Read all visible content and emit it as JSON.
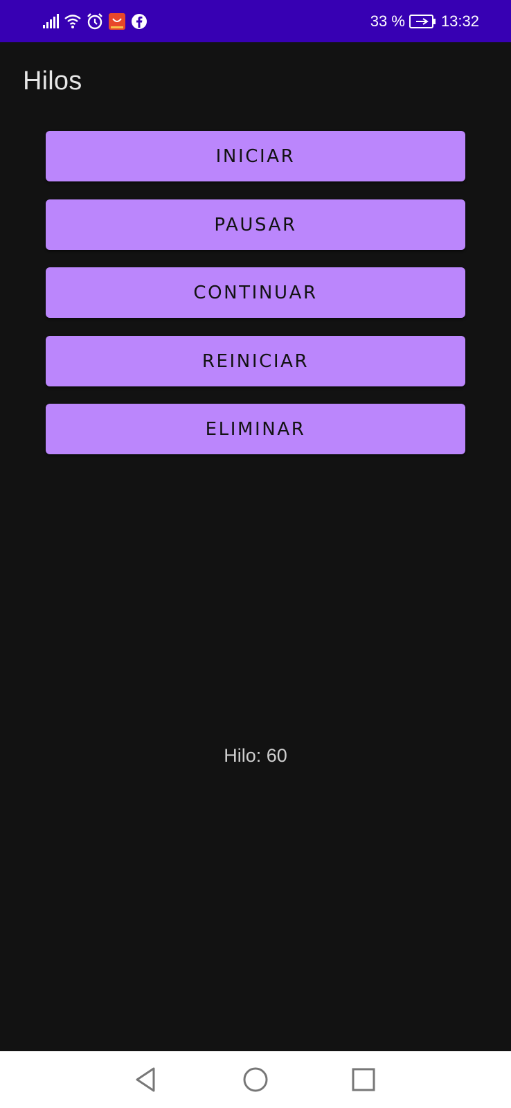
{
  "status_bar": {
    "battery_text": "33 %",
    "time": "13:32",
    "icons": [
      "signal-icon",
      "wifi-icon",
      "alarm-icon",
      "aliexpress-icon",
      "facebook-icon",
      "battery-charging-icon"
    ]
  },
  "app_bar": {
    "title": "Hilos"
  },
  "buttons": [
    {
      "label": "INICIAR"
    },
    {
      "label": "PAUSAR"
    },
    {
      "label": "CONTINUAR"
    },
    {
      "label": "REINICIAR"
    },
    {
      "label": "ELIMINAR"
    }
  ],
  "counter": {
    "text": "Hilo: 60"
  },
  "nav_bar": {
    "icons": [
      "back-icon",
      "home-icon",
      "recents-icon"
    ]
  },
  "colors": {
    "status_bar": "#3700b3",
    "background": "#121212",
    "button": "#bb86fc",
    "nav_bar": "#ffffff"
  }
}
